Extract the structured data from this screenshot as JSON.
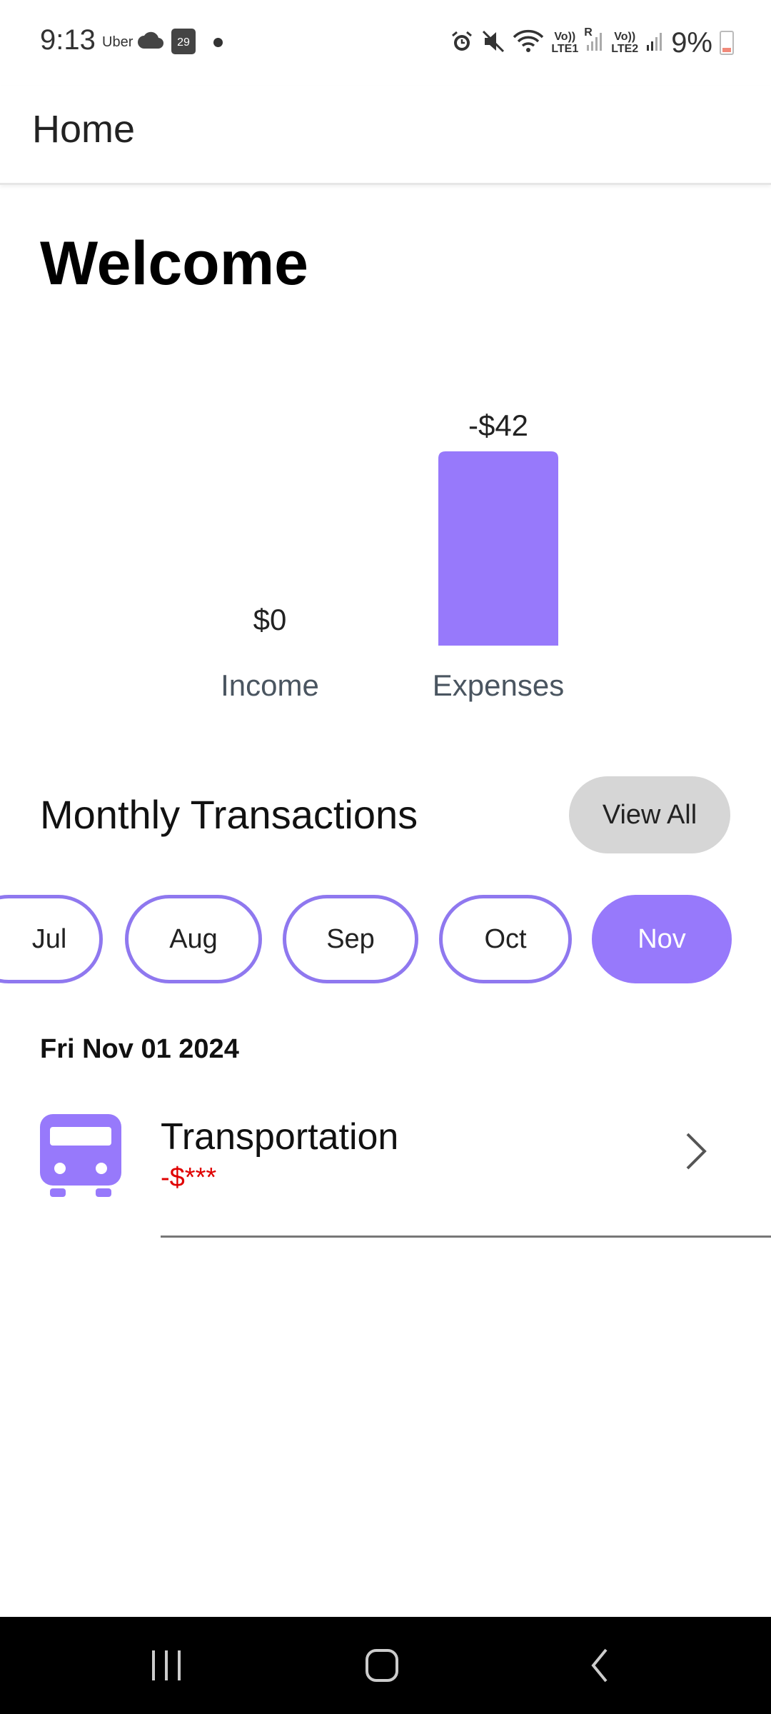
{
  "status_bar": {
    "time": "9:13",
    "uber": "Uber",
    "calendar_day": "29",
    "lte1_top": "Vo))",
    "lte1_bottom": "LTE1",
    "roaming": "R",
    "lte2_top": "Vo))",
    "lte2_bottom": "LTE2",
    "battery": "9%"
  },
  "app_bar": {
    "title": "Home"
  },
  "welcome": "Welcome",
  "chart_data": {
    "type": "bar",
    "categories": [
      "Income",
      "Expenses"
    ],
    "values": [
      0,
      42
    ],
    "value_labels": [
      "$0",
      "-$42"
    ],
    "bar_color": "#9779fb",
    "axes_visible": false,
    "grid": false
  },
  "transactions_section": {
    "title": "Monthly Transactions",
    "view_all_label": "View All"
  },
  "months": [
    {
      "label": "Jul",
      "selected": false
    },
    {
      "label": "Aug",
      "selected": false
    },
    {
      "label": "Sep",
      "selected": false
    },
    {
      "label": "Oct",
      "selected": false
    },
    {
      "label": "Nov",
      "selected": true
    }
  ],
  "day_groups": [
    {
      "date": "Fri Nov 01 2024",
      "items": [
        {
          "category": "Transportation",
          "amount": "-$***",
          "icon": "bus-icon"
        }
      ]
    }
  ],
  "colors": {
    "accent": "#9779fb",
    "pill_border": "#8f78ef",
    "negative_amount": "#e00000",
    "view_all_bg": "#d6d6d6"
  }
}
